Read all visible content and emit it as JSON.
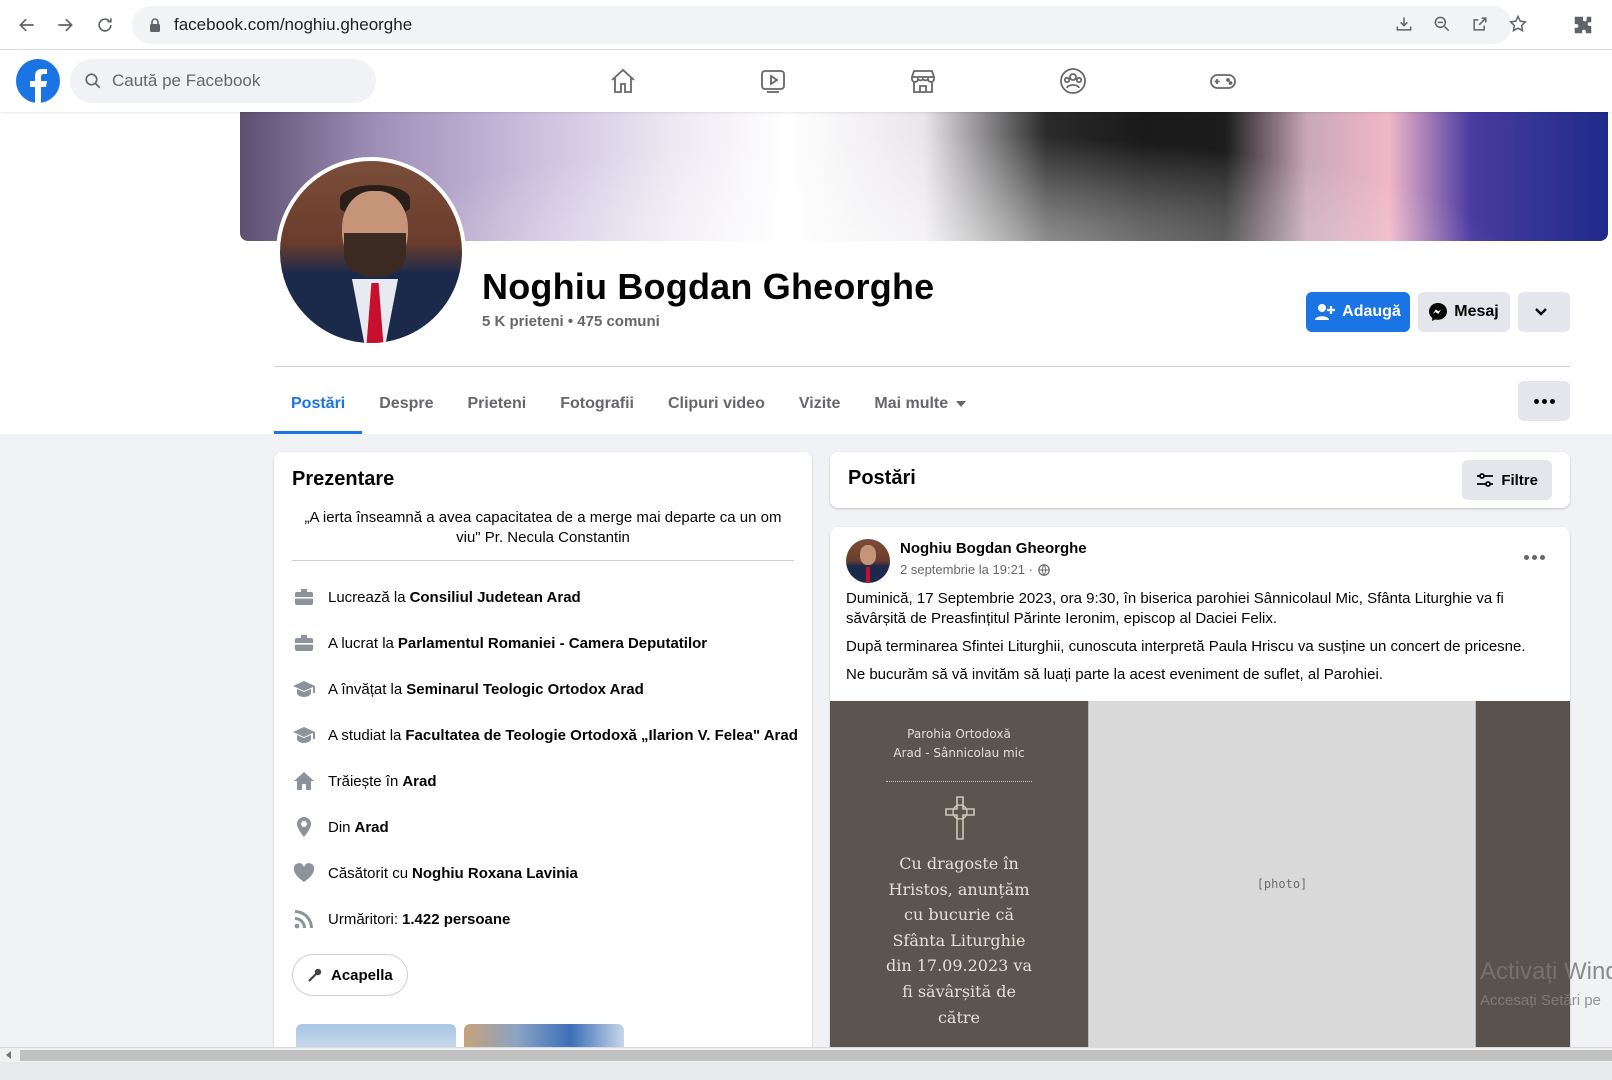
{
  "browser": {
    "url": "facebook.com/noghiu.gheorghe"
  },
  "topbar": {
    "search_placeholder": "Caută pe Facebook"
  },
  "profile": {
    "name": "Noghiu Bogdan Gheorghe",
    "meta": "5 K prieteni • 475 comuni",
    "add_button": "Adaugă",
    "message_button": "Mesaj"
  },
  "tabs": [
    "Postări",
    "Despre",
    "Prieteni",
    "Fotografii",
    "Clipuri video",
    "Vizite",
    "Mai multe"
  ],
  "intro": {
    "title": "Prezentare",
    "bio": "„A ierta înseamnă a avea capacitatea de a merge mai departe ca un om viu\" Pr. Necula Constantin",
    "items": [
      {
        "icon": "briefcase-icon",
        "pre": "Lucrează la",
        "bold": "Consiliul Judetean Arad",
        "post": ""
      },
      {
        "icon": "briefcase-icon",
        "pre": "A lucrat la",
        "bold": "Parlamentul Romaniei - Camera Deputatilor",
        "post": ""
      },
      {
        "icon": "graduation-cap-icon",
        "pre": "A învățat la",
        "bold": "Seminarul Teologic Ortodox Arad",
        "post": ""
      },
      {
        "icon": "graduation-cap-icon",
        "pre": "A studiat la",
        "bold": "Facultatea de Teologie Ortodoxă „Ilarion V. Felea\" Arad",
        "post": ""
      },
      {
        "icon": "home-icon",
        "pre": "Trăiește în",
        "bold": "Arad",
        "post": ""
      },
      {
        "icon": "location-pin-icon",
        "pre": "Din",
        "bold": "Arad",
        "post": ""
      },
      {
        "icon": "heart-icon",
        "pre": "Căsătorit cu",
        "bold": "Noghiu Roxana Lavinia",
        "post": ""
      },
      {
        "icon": "rss-icon",
        "pre": "Urmăritori:",
        "bold": "1.422 persoane",
        "post": ""
      }
    ],
    "hobby": "Acapella"
  },
  "posts_header": {
    "title": "Postări",
    "filter": "Filtre"
  },
  "post": {
    "author": "Noghiu Bogdan Gheorghe",
    "time": "2 septembrie la 19:21 ·",
    "paragraphs": [
      "Duminică, 17 Septembrie 2023,  ora 9:30, în biserica parohiei Sânnicolaul Mic, Sfânta Liturghie va fi săvârșită de Preasfințitul Părinte Ieronim, episcop al Daciei Felix.",
      "După terminarea Sfintei Liturghii, cunoscuta interpretă Paula Hriscu va susține un concert de pricesne.",
      "Ne bucurăm să vă invităm să luați parte la acest eveniment de suflet, al Parohiei."
    ],
    "invite_header": [
      "Parohia Ortodoxă",
      "Arad - Sânnicolau mic"
    ],
    "invite_message": [
      "Cu dragoste în",
      "Hristos, anunțăm",
      "cu bucurie că",
      "Sfânta Liturghie",
      "din 17.09.2023 va",
      "fi săvârșită de",
      "către"
    ]
  },
  "os_watermark": {
    "line1": "Activați Wind",
    "line2": "Accesați Setări pe"
  },
  "colors": {
    "fb_blue": "#1b74e4",
    "background": "#f0f2f5"
  }
}
